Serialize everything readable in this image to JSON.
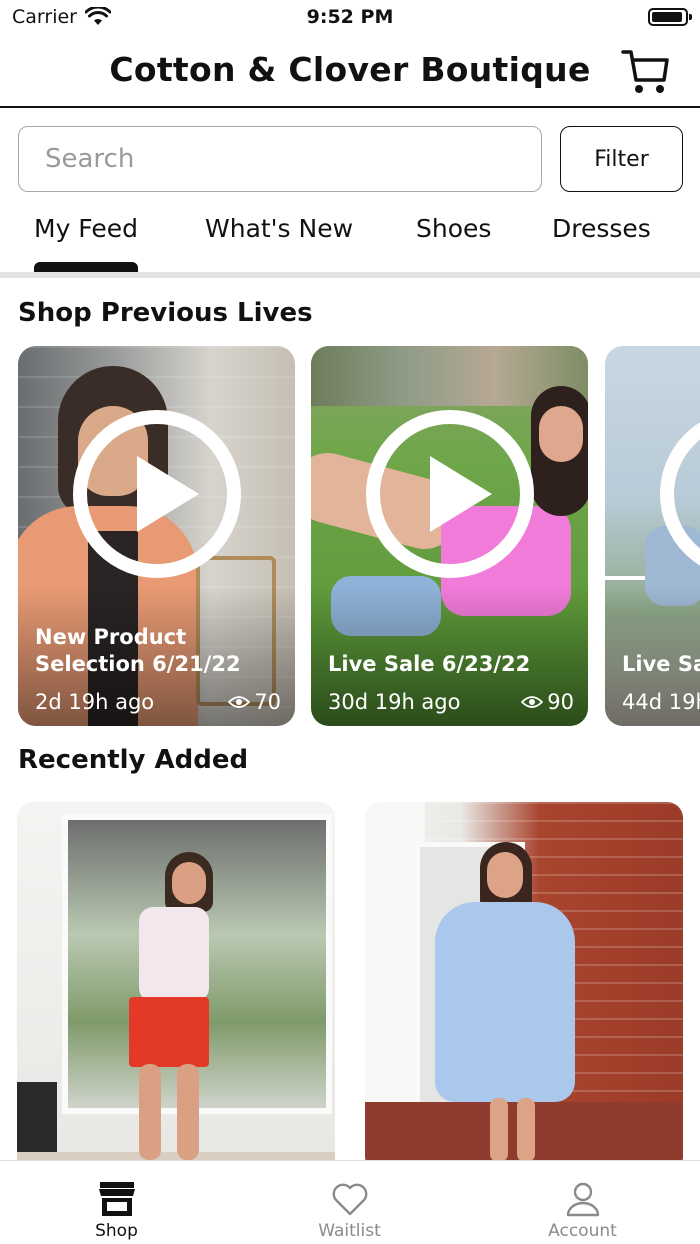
{
  "status_bar": {
    "carrier": "Carrier",
    "time": "9:52 PM"
  },
  "header": {
    "title": "Cotton & Clover Boutique"
  },
  "search": {
    "placeholder": "Search",
    "value": ""
  },
  "filter": {
    "label": "Filter"
  },
  "tabs": [
    {
      "label": "My Feed",
      "active": true
    },
    {
      "label": "What's New",
      "active": false
    },
    {
      "label": "Shoes",
      "active": false
    },
    {
      "label": "Dresses",
      "active": false
    }
  ],
  "lives": {
    "title": "Shop Previous Lives",
    "items": [
      {
        "title": "New Product Selection 6/21/22",
        "ago": "2d 19h ago",
        "views": "70"
      },
      {
        "title": "Live Sale 6/23/22",
        "ago": "30d 19h ago",
        "views": "90"
      },
      {
        "title": "Live Sa",
        "ago": "44d 19h",
        "views": ""
      }
    ]
  },
  "recent": {
    "title": "Recently Added"
  },
  "tabbar": {
    "items": [
      {
        "label": "Shop",
        "icon": "store-icon",
        "active": true
      },
      {
        "label": "Waitlist",
        "icon": "heart-icon",
        "active": false
      },
      {
        "label": "Account",
        "icon": "person-icon",
        "active": false
      }
    ]
  },
  "colors": {
    "text": "#111111",
    "inactive": "#8a8a8a",
    "divider": "#e3e3e3"
  }
}
